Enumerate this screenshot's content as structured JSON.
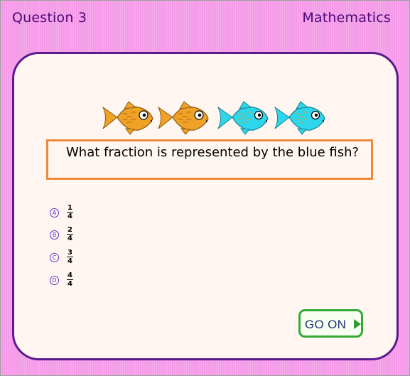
{
  "header": {
    "question_label": "Question 3",
    "subject": "Mathematics"
  },
  "picture": {
    "fish": [
      {
        "color": "orange",
        "hex": "#f0a226",
        "icon": "orange-fish-icon"
      },
      {
        "color": "orange",
        "hex": "#f0a226",
        "icon": "orange-fish-icon"
      },
      {
        "color": "blue",
        "hex": "#2ed6ec",
        "icon": "blue-fish-icon"
      },
      {
        "color": "blue",
        "hex": "#2ed6ec",
        "icon": "blue-fish-icon"
      }
    ]
  },
  "question": {
    "text": "What fraction is represented by the blue fish?"
  },
  "choices": [
    {
      "letter": "A",
      "numerator": "1",
      "denominator": "4"
    },
    {
      "letter": "B",
      "numerator": "2",
      "denominator": "4"
    },
    {
      "letter": "C",
      "numerator": "3",
      "denominator": "4"
    },
    {
      "letter": "D",
      "numerator": "4",
      "denominator": "4"
    }
  ],
  "go_button": {
    "label": "GO ON"
  },
  "colors": {
    "background": "#f49ae8",
    "card_border": "#5a1b8f",
    "question_border": "#ec8a3a",
    "button_border": "#33aa33"
  }
}
